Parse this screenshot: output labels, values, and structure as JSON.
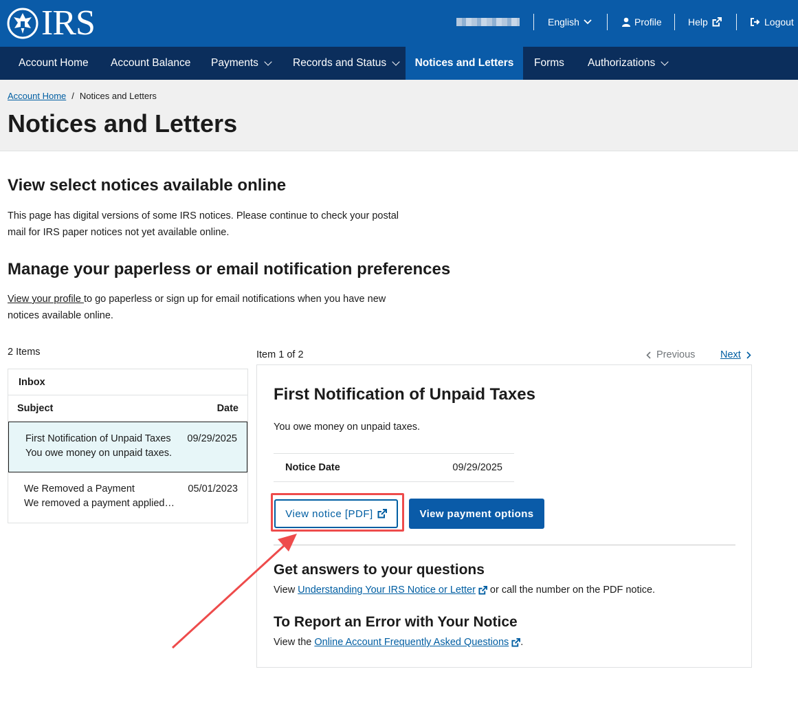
{
  "header": {
    "logo_text": "IRS",
    "language": "English",
    "profile": "Profile",
    "help": "Help",
    "logout": "Logout"
  },
  "nav": {
    "items": [
      {
        "label": "Account Home"
      },
      {
        "label": "Account Balance"
      },
      {
        "label": "Payments"
      },
      {
        "label": "Records and Status"
      },
      {
        "label": "Notices and Letters"
      },
      {
        "label": "Forms"
      },
      {
        "label": "Authorizations"
      }
    ],
    "active": "Notices and Letters"
  },
  "breadcrumb": {
    "home": "Account Home",
    "sep": "/",
    "current": "Notices and Letters"
  },
  "page_title": "Notices and Letters",
  "intro": {
    "heading": "View select notices available online",
    "text": "This page has digital versions of some IRS notices. Please continue to check your postal mail for IRS paper notices not yet available online."
  },
  "prefs": {
    "heading": "Manage your paperless or email notification preferences",
    "link": "View your profile ",
    "text": "to go paperless or sign up for email notifications when you have new notices available online."
  },
  "inbox": {
    "count": "2 Items",
    "title": "Inbox",
    "col_subject": "Subject",
    "col_date": "Date",
    "rows": [
      {
        "title": "First Notification of Unpaid Taxes",
        "summary": "You owe money on unpaid taxes.",
        "date": "09/29/2025"
      },
      {
        "title": "We Removed a Payment",
        "summary": "We removed a payment applied…",
        "date": "05/01/2023"
      }
    ]
  },
  "pager": {
    "status": "Item 1 of 2",
    "previous": "Previous",
    "next": "Next"
  },
  "detail": {
    "title": "First Notification of Unpaid Taxes",
    "summary": "You owe money on unpaid taxes.",
    "notice_date_label": "Notice Date",
    "notice_date": "09/29/2025",
    "view_notice": "View notice [PDF]",
    "view_payment": "View payment options",
    "questions_heading": "Get answers to your questions",
    "questions_pre": "View",
    "questions_link": "Understanding Your IRS Notice or Letter",
    "questions_post": "or call the number on the PDF notice.",
    "report_heading": "To Report an Error with Your Notice",
    "report_pre": "View the",
    "report_link": "Online Account Frequently Asked Questions",
    "report_post": "."
  },
  "colors": {
    "header_blue": "#0a5ba8",
    "nav_navy": "#0b2e5c",
    "link_blue": "#005ea2",
    "highlight_red": "#ee4b4b",
    "selected_row": "#e7f6f8"
  }
}
